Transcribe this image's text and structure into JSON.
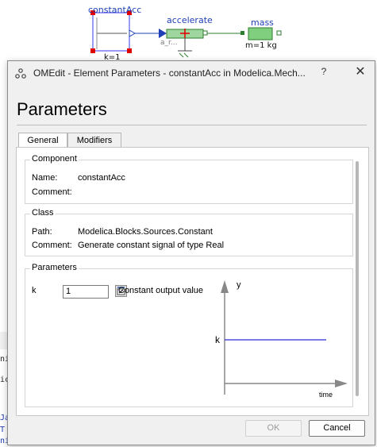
{
  "diagram": {
    "constant_name": "constantAcc",
    "constant_param": "k=1",
    "accelerate_name": "accelerate",
    "accelerate_sub": "a_r...",
    "mass_name": "mass",
    "mass_param": "m=1 kg",
    "left_texts": [
      "ni",
      "ic",
      "Ja",
      "T",
      "ni"
    ]
  },
  "dialog": {
    "title": "OMEdit - Element Parameters - constantAcc in Modelica.Mech...",
    "help": "?",
    "close": "✕",
    "heading": "Parameters",
    "tabs": [
      {
        "label": "General",
        "active": true
      },
      {
        "label": "Modifiers",
        "active": false
      }
    ],
    "component": {
      "title": "Component",
      "name_label": "Name:",
      "name_value": "constantAcc",
      "comment_label": "Comment:",
      "comment_value": ""
    },
    "class": {
      "title": "Class",
      "path_label": "Path:",
      "path_value": "Modelica.Blocks.Sources.Constant",
      "comment_label": "Comment:",
      "comment_value": "Generate constant signal of type Real"
    },
    "parameters": {
      "title": "Parameters",
      "k_label": "k",
      "k_value": "1",
      "k_description": "Constant output value",
      "plot_y_label": "y",
      "plot_k_label": "k",
      "plot_x_label": "time"
    },
    "ok_label": "OK",
    "cancel_label": "Cancel"
  }
}
